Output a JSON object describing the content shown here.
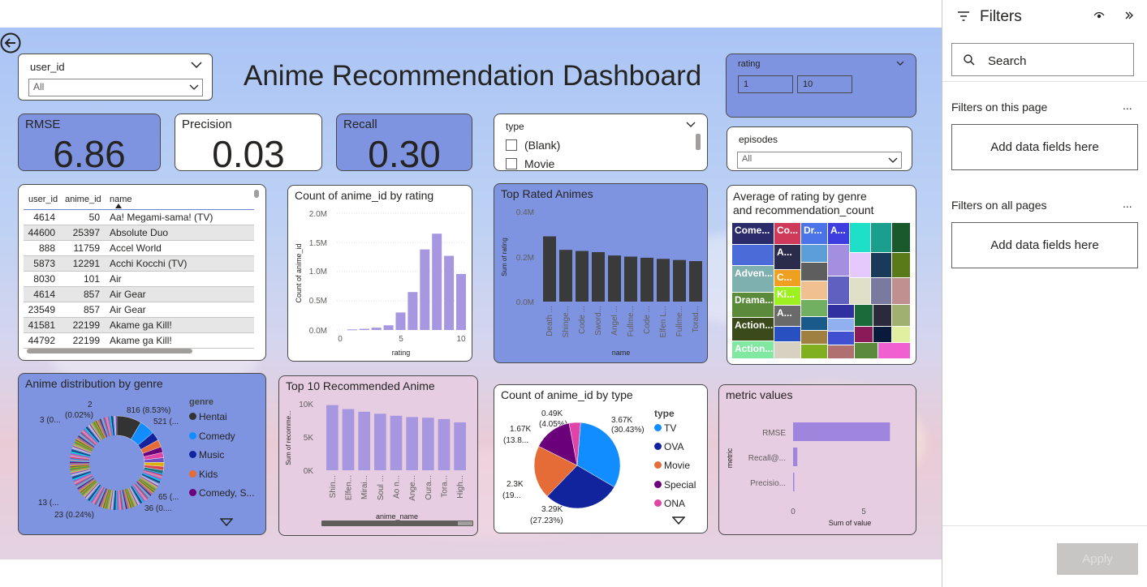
{
  "title": "Anime Recommendation Dashboard",
  "back_icon": "arrow-left-circle-icon",
  "slicers": {
    "user_id": {
      "label": "user_id",
      "value": "All"
    },
    "rating": {
      "label": "rating",
      "min": "1",
      "max": "10"
    },
    "type": {
      "label": "type",
      "options": [
        "(Blank)",
        "Movie"
      ]
    },
    "episodes": {
      "label": "episodes",
      "value": "All"
    }
  },
  "kpis": {
    "rmse": {
      "label": "RMSE",
      "value": "6.86"
    },
    "precision": {
      "label": "Precision",
      "value": "0.03"
    },
    "recall": {
      "label": "Recall",
      "value": "0.30"
    }
  },
  "table": {
    "headers": [
      "user_id",
      "anime_id",
      "name"
    ],
    "rows": [
      [
        "4614",
        "50",
        "Aa! Megami-sama! (TV)"
      ],
      [
        "44600",
        "25397",
        "Absolute Duo"
      ],
      [
        "888",
        "11759",
        "Accel World"
      ],
      [
        "5873",
        "12291",
        "Acchi Kocchi (TV)"
      ],
      [
        "8030",
        "101",
        "Air"
      ],
      [
        "4614",
        "857",
        "Air Gear"
      ],
      [
        "23549",
        "857",
        "Air Gear"
      ],
      [
        "41581",
        "22199",
        "Akame ga Kill!"
      ],
      [
        "44792",
        "22199",
        "Akame ga Kill!"
      ]
    ]
  },
  "count_by_rating": {
    "title": "Count of anime_id by rating",
    "ylabel": "Count of anime_id",
    "xlabel": "rating",
    "yticks": [
      "2.0M",
      "1.5M",
      "1.0M",
      "0.5M",
      "0.0M"
    ],
    "xticks": [
      "0",
      "5",
      "10"
    ]
  },
  "top_rated": {
    "title": "Top Rated Animes",
    "ylabel": "Sum of rating",
    "xlabel": "name",
    "yticks": [
      "0.4M",
      "0.2M",
      "0.0M"
    ],
    "labels": [
      "Death ...",
      "Shinge...",
      "Code ...",
      "Sword...",
      "Angel ...",
      "Fullme...",
      "Code ...",
      "Elfen L...",
      "Fullme...",
      "Torad..."
    ]
  },
  "treemap": {
    "title_line1": "Average of rating by genre",
    "title_line2": "and recommendation_count",
    "labels": [
      "Come...",
      "Co...",
      "Dr...",
      "A...",
      "A...",
      "Adven...",
      "C...",
      "Drama...",
      "Ki...",
      "Action...",
      "A...",
      "Action..."
    ]
  },
  "genre_dist": {
    "title": "Anime distribution by genre",
    "legend_title": "genre",
    "legend": [
      {
        "name": "Hentai",
        "color": "#333333"
      },
      {
        "name": "Comedy",
        "color": "#118dff"
      },
      {
        "name": "Music",
        "color": "#12239e"
      },
      {
        "name": "Kids",
        "color": "#e66c37"
      },
      {
        "name": "Comedy, S...",
        "color": "#6b007b"
      }
    ],
    "labels": [
      "816 (8.53%)",
      "521 (...",
      "2",
      "(0.02%)",
      "3 (0...",
      "65 (...",
      "36 (0....",
      "13 (...",
      "23 (0.24%)"
    ],
    "more_icon": "caret-down-icon"
  },
  "top10": {
    "title": "Top 10 Recommended Anime",
    "ylabel": "Sum of recomme...",
    "xlabel": "anime_name",
    "yticks": [
      "10K",
      "5K",
      "0K"
    ],
    "labels": [
      "Shin...",
      "Elfen...",
      "Mirai...",
      "Soul ...",
      "Ao n...",
      "Ange...",
      "Oura...",
      "Tora...",
      "High..."
    ]
  },
  "type_pie": {
    "title": "Count of anime_id by type",
    "legend_title": "type",
    "legend": [
      {
        "name": "TV",
        "color": "#118dff"
      },
      {
        "name": "OVA",
        "color": "#12239e"
      },
      {
        "name": "Movie",
        "color": "#e66c37"
      },
      {
        "name": "Special",
        "color": "#6b007b"
      },
      {
        "name": "ONA",
        "color": "#e044a7"
      }
    ],
    "labels": {
      "tv_a": "3.67K",
      "tv_b": "(30.43%)",
      "ova_a": "3.29K",
      "ova_b": "(27.23%)",
      "movie_a": "2.3K",
      "movie_b": "(19...",
      "special_a": "1.67K",
      "special_b": "(13.8...",
      "ona_a": "0.49K",
      "ona_b": "(4.05%)"
    },
    "more_icon": "caret-down-icon"
  },
  "metric_values": {
    "title": "metric values",
    "ylabel": "metric",
    "xlabel": "Sum of value",
    "categories": [
      "RMSE",
      "Recall@...",
      "Precisio..."
    ],
    "xticks": [
      "0",
      "5"
    ]
  },
  "filters": {
    "title": "Filters",
    "search_placeholder": "Search",
    "this_page": "Filters on this page",
    "all_pages": "Filters on all pages",
    "add_fields": "Add data fields here",
    "more": "...",
    "apply": "Apply"
  },
  "chart_data": [
    {
      "type": "bar",
      "title": "Count of anime_id by rating",
      "xlabel": "rating",
      "ylabel": "Count of anime_id",
      "categories": [
        "1",
        "2",
        "3",
        "4",
        "5",
        "6",
        "7",
        "8",
        "9",
        "10"
      ],
      "values": [
        0.01,
        0.02,
        0.04,
        0.08,
        0.3,
        0.65,
        1.38,
        1.65,
        1.27,
        0.96
      ],
      "unit": "M",
      "ylim": [
        0,
        2.0
      ],
      "xlim": [
        0,
        10
      ]
    },
    {
      "type": "bar",
      "title": "Top Rated Animes",
      "xlabel": "name",
      "ylabel": "Sum of rating",
      "categories": [
        "Death ...",
        "Shinge...",
        "Code ...",
        "Sword...",
        "Angel ...",
        "Fullme...",
        "Code ...",
        "Elfen L...",
        "Fullme...",
        "Torad..."
      ],
      "values": [
        0.29,
        0.23,
        0.225,
        0.22,
        0.205,
        0.2,
        0.195,
        0.19,
        0.185,
        0.18
      ],
      "unit": "M",
      "ylim": [
        0,
        0.4
      ]
    },
    {
      "type": "bar",
      "title": "Top 10 Recommended Anime",
      "xlabel": "anime_name",
      "ylabel": "Sum of recomme...",
      "categories": [
        "Shin...",
        "Elfen...",
        "Mirai...",
        "Soul ...",
        "Ao n...",
        "Ange...",
        "Oura...",
        "Tora...",
        "High..."
      ],
      "values": [
        9800,
        9200,
        8800,
        8500,
        8200,
        8000,
        7900,
        7700,
        7200
      ],
      "ylim": [
        0,
        10000
      ]
    },
    {
      "type": "pie",
      "title": "Count of anime_id by type",
      "categories": [
        "TV",
        "OVA",
        "Movie",
        "Special",
        "ONA"
      ],
      "values": [
        3670,
        3290,
        2300,
        1670,
        490
      ],
      "percent": [
        30.43,
        27.23,
        19,
        13.8,
        4.05
      ]
    },
    {
      "type": "bar",
      "title": "metric values",
      "xlabel": "Sum of value",
      "ylabel": "metric",
      "categories": [
        "RMSE",
        "Recall@...",
        "Precisio..."
      ],
      "values": [
        6.86,
        0.3,
        0.03
      ],
      "xlim": [
        0,
        8
      ]
    },
    {
      "type": "pie",
      "title": "Anime distribution by genre",
      "categories": [
        "Hentai",
        "Comedy",
        "Music",
        "Kids",
        "Comedy, S..."
      ],
      "values": [
        816,
        521,
        65,
        36,
        23
      ],
      "percent": [
        8.53,
        5.4,
        0.68,
        0.38,
        0.24
      ]
    }
  ]
}
